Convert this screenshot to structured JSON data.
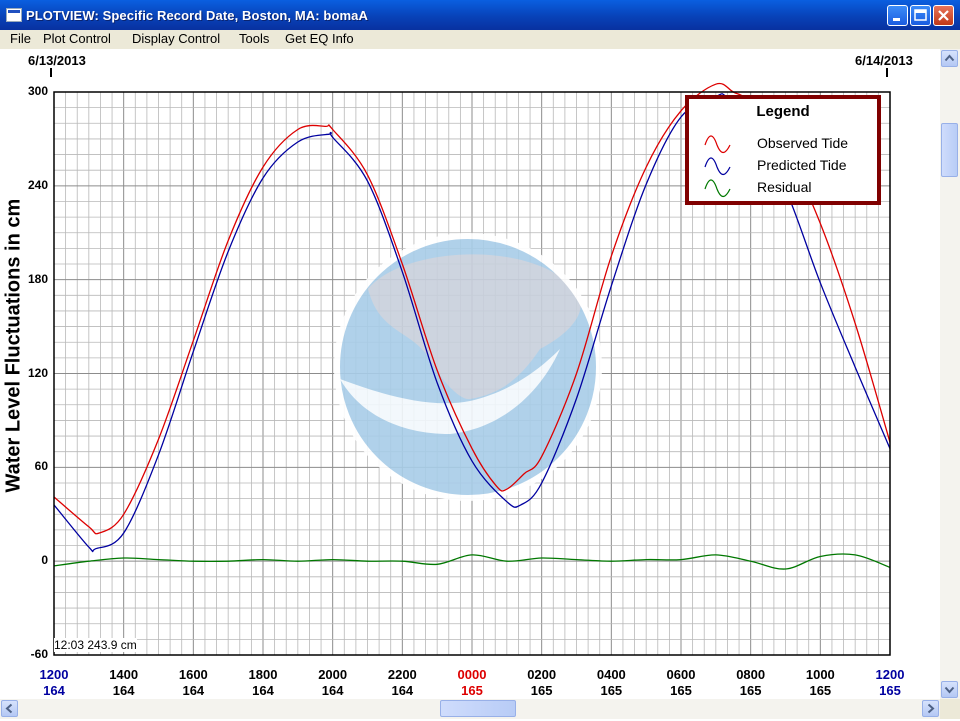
{
  "window": {
    "title": "PLOTVIEW: Specific Record Date, Boston, MA: bomaA"
  },
  "menu": [
    "File",
    "Plot Control",
    "Display Control",
    "Tools",
    "Get EQ Info"
  ],
  "dates": {
    "start": "6/13/2013",
    "end": "6/14/2013"
  },
  "readout": "12:03 243.9 cm",
  "colors": {
    "observed": "#dd0000",
    "predicted": "#0000a0",
    "residual": "#007800",
    "legend_border": "#800000",
    "watermark": "#c8d0dc",
    "watermark_blue": "#a8cde8"
  },
  "chart_data": {
    "type": "line",
    "ylabel": "Water Level Fluctuations in cm",
    "ylim": [
      -60,
      300
    ],
    "yticks": [
      300,
      240,
      180,
      120,
      60,
      0,
      -60
    ],
    "xlim_hours": [
      12,
      36
    ],
    "x_tick_labels": [
      {
        "time": "1200",
        "day": "164",
        "color": "#0000a0"
      },
      {
        "time": "1400",
        "day": "164",
        "color": "#000000"
      },
      {
        "time": "1600",
        "day": "164",
        "color": "#000000"
      },
      {
        "time": "1800",
        "day": "164",
        "color": "#000000"
      },
      {
        "time": "2000",
        "day": "164",
        "color": "#000000"
      },
      {
        "time": "2200",
        "day": "164",
        "color": "#000000"
      },
      {
        "time": "0000",
        "day": "165",
        "color": "#dd0000"
      },
      {
        "time": "0200",
        "day": "165",
        "color": "#000000"
      },
      {
        "time": "0400",
        "day": "165",
        "color": "#000000"
      },
      {
        "time": "0600",
        "day": "165",
        "color": "#000000"
      },
      {
        "time": "0800",
        "day": "165",
        "color": "#000000"
      },
      {
        "time": "1000",
        "day": "165",
        "color": "#000000"
      },
      {
        "time": "1200",
        "day": "165",
        "color": "#0000a0"
      }
    ],
    "legend": {
      "title": "Legend",
      "entries": [
        "Observed Tide",
        "Predicted Tide",
        "Residual"
      ]
    },
    "series": [
      {
        "name": "Observed Tide",
        "x": [
          12,
          13,
          13.3,
          14,
          15,
          16,
          17,
          18,
          19,
          19.8,
          20,
          21,
          22,
          23,
          24,
          24.7,
          25,
          25.5,
          26,
          27,
          28,
          29,
          30,
          31,
          31.5,
          32,
          33,
          34,
          35,
          36
        ],
        "y": [
          41,
          22,
          18,
          30,
          78,
          141,
          205,
          252,
          276,
          278,
          276,
          247,
          190,
          122,
          72,
          48,
          46,
          56,
          67,
          120,
          195,
          252,
          288,
          305,
          300,
          293,
          264,
          216,
          152,
          76
        ]
      },
      {
        "name": "Predicted Tide",
        "x": [
          12,
          13,
          13.2,
          14,
          15,
          16,
          17,
          18,
          19,
          19.9,
          20,
          21,
          22,
          23,
          24,
          25,
          25.4,
          26,
          27,
          28,
          29,
          30,
          31,
          31.3,
          32,
          33,
          34,
          35,
          36
        ],
        "y": [
          36,
          9,
          8,
          18,
          68,
          134,
          198,
          245,
          268,
          273,
          271,
          243,
          185,
          114,
          64,
          38,
          36,
          50,
          104,
          176,
          241,
          284,
          297,
          297,
          280,
          238,
          178,
          124,
          72
        ]
      },
      {
        "name": "Residual",
        "x": [
          12,
          13,
          14,
          15,
          16,
          17,
          18,
          19,
          20,
          21,
          22,
          23,
          24,
          25,
          26,
          27,
          28,
          29,
          30,
          31,
          32,
          33,
          34,
          35,
          36
        ],
        "y": [
          -3,
          0,
          2,
          1,
          0,
          0,
          1,
          0,
          1,
          0,
          0,
          -2,
          4,
          0,
          2,
          1,
          0,
          1,
          1,
          4,
          0,
          -5,
          3,
          4,
          -4
        ]
      }
    ]
  }
}
